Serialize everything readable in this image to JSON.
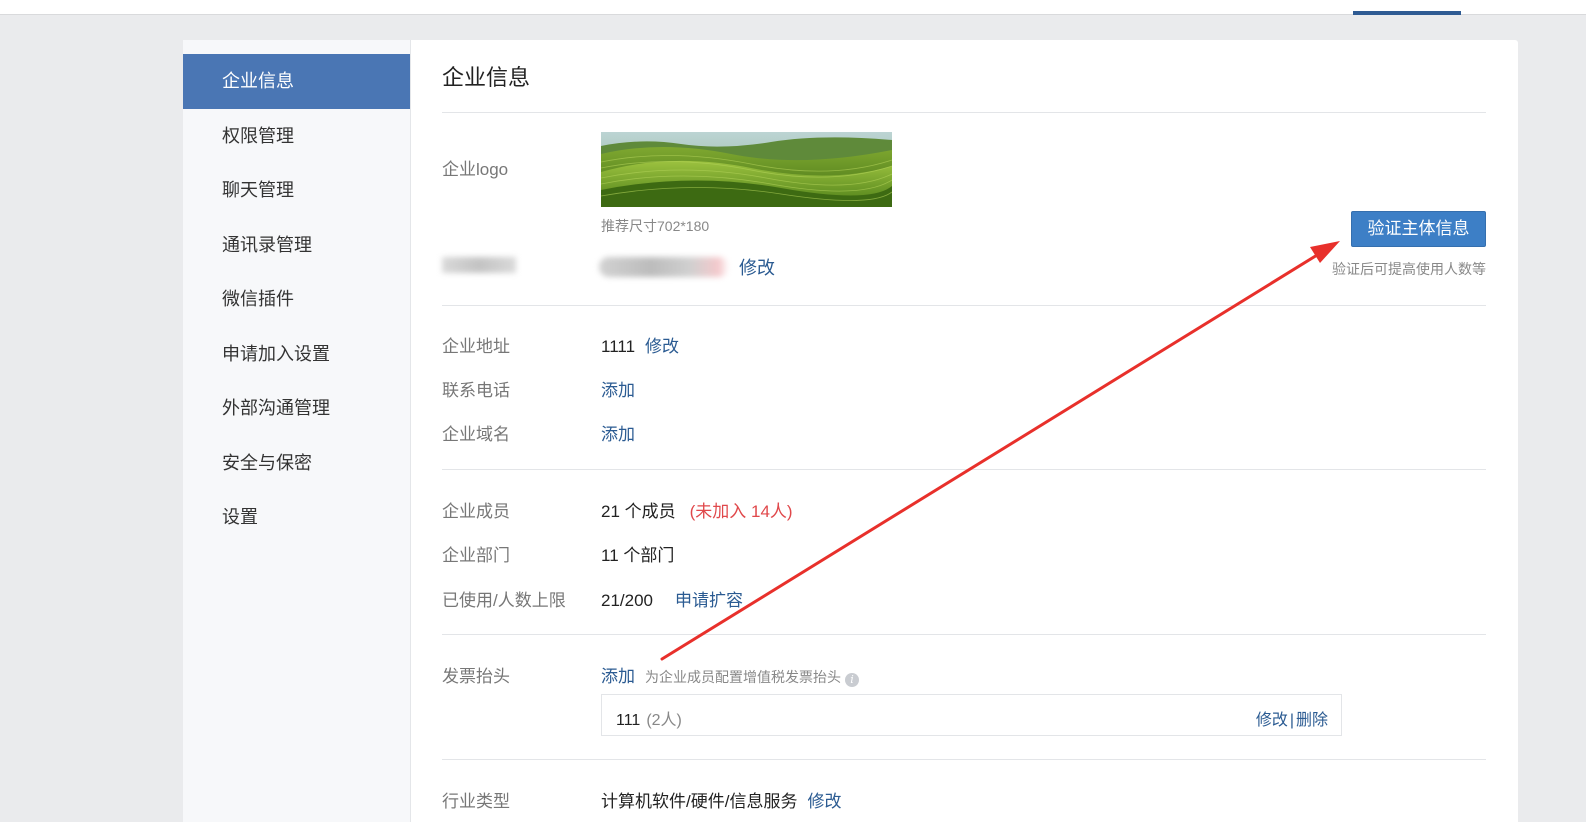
{
  "sidebar": {
    "items": [
      {
        "label": "企业信息",
        "active": true
      },
      {
        "label": "权限管理"
      },
      {
        "label": "聊天管理"
      },
      {
        "label": "通讯录管理"
      },
      {
        "label": "微信插件"
      },
      {
        "label": "申请加入设置"
      },
      {
        "label": "外部沟通管理"
      },
      {
        "label": "安全与保密"
      },
      {
        "label": "设置"
      }
    ]
  },
  "main": {
    "title": "企业信息",
    "logo": {
      "label": "企业logo",
      "hint": "推荐尺寸702*180",
      "image_icon": "landscape-image"
    },
    "name": {
      "edit": "修改"
    },
    "verify": {
      "button": "验证主体信息",
      "hint": "验证后可提高使用人数等"
    },
    "address": {
      "label": "企业地址",
      "value": "1111",
      "edit": "修改"
    },
    "phone": {
      "label": "联系电话",
      "action": "添加"
    },
    "domain": {
      "label": "企业域名",
      "action": "添加"
    },
    "members": {
      "label": "企业成员",
      "value": "21 个成员",
      "unjoined": "(未加入 14人)"
    },
    "departments": {
      "label": "企业部门",
      "value": "11 个部门"
    },
    "usage": {
      "label": "已使用/人数上限",
      "value": "21/200",
      "action": "申请扩容"
    },
    "invoice": {
      "label": "发票抬头",
      "action": "添加",
      "hint": "为企业成员配置增值税发票抬头",
      "info_icon": "i",
      "entry": {
        "name": "111",
        "count": "(2人)",
        "edit": "修改",
        "separator": "|",
        "delete": "删除"
      }
    },
    "industry": {
      "label": "行业类型",
      "value": "计算机软件/硬件/信息服务",
      "edit": "修改"
    }
  },
  "colors": {
    "accent": "#4a76b4",
    "button": "#3d7fc6",
    "link": "#2b5b92",
    "warning": "#e0484b",
    "annotation_arrow": "#e8302b"
  }
}
